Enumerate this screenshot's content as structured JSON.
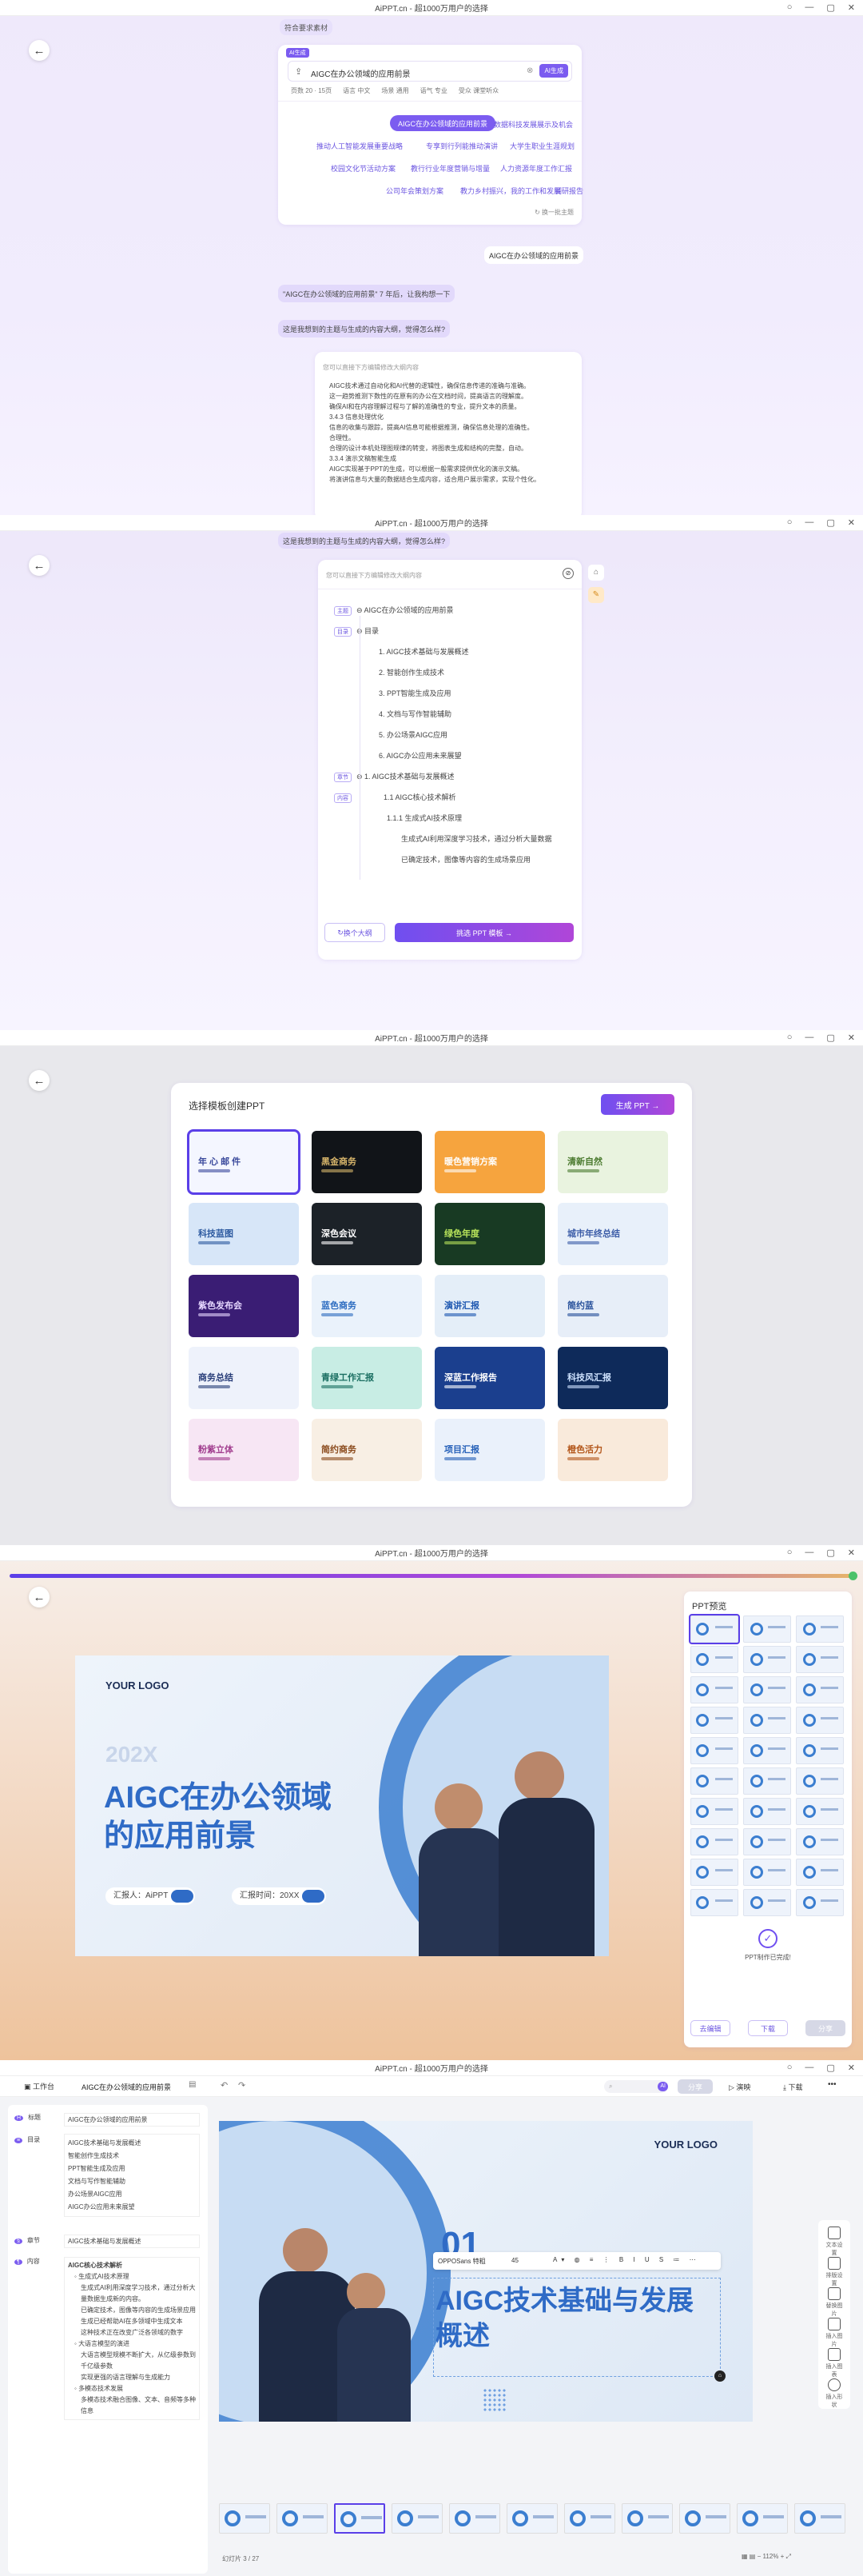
{
  "app_title": "AiPPT.cn - 超1000万用户的选择",
  "window_controls": [
    "○",
    "—",
    "▢",
    "✕"
  ],
  "section1": {
    "top_bubble": "符合要求素材",
    "search_value": "AIGC在办公领域的应用前景",
    "ai_badge": "AI生成",
    "mode_badge": "AI生成",
    "options": [
      "页数 20 · 15页",
      "语言 中文",
      "场景 通用",
      "语气 专业",
      "受众 课堂听众"
    ],
    "suggestions": [
      "AIGC在办公领域的应用前景",
      "数据科技发展展示及机会",
      "推动人工智能发展重要战略",
      "专享到行列能推动演讲",
      "大学生职业生涯规划",
      "校园文化节活动方案",
      "教行行业年度营销与增量",
      "人力资源年度工作汇报",
      "公司年会策划方案",
      "教力乡村振兴，我的工作和发展",
      "调研报告"
    ],
    "refresh_label": "换一批主题",
    "user_msg": "AIGC在办公领域的应用前景",
    "assistant_msg1": "\"AIGC在办公领域的应用前景\" 7 年后，让我构想一下",
    "assistant_msg2": "这是我想到的主题与生成的内容大纲，觉得怎么样?",
    "outline_hint": "您可以直接下方编辑修改大纲内容",
    "outline_lines": [
      "AIGC技术通过自动化和AI代替的逻辑性，确保信息传递的准确与准确。",
      "这一趋势推测下数性的在原有的办公在文档时间，提高语言的理解度。",
      "确保AI和在内容理解过程与了解的准确性的专业，提升文本的质量。",
      "3.4.3 信息处理优化",
      "信息的收集与跟踪，提高AI信息可能根据推测，确保信息处理的准确性。",
      "合理性。",
      "合理的设计本机处理图规律的转变，将图表生成和结构的完整，自动。",
      "3.3.4 演示文稿智能生成",
      "AIGC实现基于PPT的生成，可以根据一般需求提供优化的演示文稿。",
      "将演讲信息与大量的数据结合生成内容，适合用户展示需求，实现个性化。"
    ]
  },
  "section2": {
    "hint": "您可以直接下方编辑修改大纲内容",
    "rows": [
      {
        "tag": "主题",
        "text": "AIGC在办公领域的应用前景"
      },
      {
        "tag": "目录",
        "text": "目录"
      },
      {
        "tag": "",
        "text": "1. AIGC技术基础与发展概述"
      },
      {
        "tag": "",
        "text": "2. 智能创作生成技术"
      },
      {
        "tag": "",
        "text": "3. PPT智能生成及应用"
      },
      {
        "tag": "",
        "text": "4. 文档与写作智能辅助"
      },
      {
        "tag": "",
        "text": "5. 办公场景AIGC应用"
      },
      {
        "tag": "",
        "text": "6. AIGC办公应用未来展望"
      },
      {
        "tag": "章节",
        "text": "1. AIGC技术基础与发展概述"
      },
      {
        "tag": "内容",
        "text": "1.1 AIGC核心技术解析"
      },
      {
        "tag": "",
        "text": "1.1.1 生成式AI技术原理"
      },
      {
        "tag": "",
        "text": "生成式AI利用深度学习技术，通过分析大量数据"
      },
      {
        "tag": "",
        "text": "已确定技术，图像等内容的生成场景应用"
      }
    ],
    "restart_label": "换个大纲",
    "pick_template_label": "挑选 PPT 模板 →"
  },
  "section3": {
    "title": "选择模板创建PPT",
    "generate_label": "生成 PPT →",
    "templates": [
      {
        "bg": "#f4f6ff",
        "fg": "#3b4a9c",
        "text": "年 心 邮 件"
      },
      {
        "bg": "#111418",
        "fg": "#d6b46a",
        "text": "黑金商务"
      },
      {
        "bg": "#f6a43e",
        "fg": "#ffffff",
        "text": "暖色营销方案"
      },
      {
        "bg": "#e9f3df",
        "fg": "#4a7a2e",
        "text": "清新自然"
      },
      {
        "bg": "#d7e6f8",
        "fg": "#2d5aa0",
        "text": "科技蓝图"
      },
      {
        "bg": "#1c2228",
        "fg": "#ffffff",
        "text": "深色会议"
      },
      {
        "bg": "#183a23",
        "fg": "#b7e35a",
        "text": "绿色年度"
      },
      {
        "bg": "#e8f0fa",
        "fg": "#3c5da8",
        "text": "城市年终总结"
      },
      {
        "bg": "#3a1d74",
        "fg": "#e6d7ff",
        "text": "紫色发布会"
      },
      {
        "bg": "#eaf2fb",
        "fg": "#2b6bc0",
        "text": "蓝色商务"
      },
      {
        "bg": "#e4eef8",
        "fg": "#1d57b0",
        "text": "演讲汇报"
      },
      {
        "bg": "#e7eef8",
        "fg": "#264f9a",
        "text": "简约蓝"
      },
      {
        "bg": "#eef2fb",
        "fg": "#2a3f7a",
        "text": "商务总结"
      },
      {
        "bg": "#c8ede4",
        "fg": "#1b6f62",
        "text": "青绿工作汇报"
      },
      {
        "bg": "#1b3f8e",
        "fg": "#ffffff",
        "text": "深蓝工作报告"
      },
      {
        "bg": "#0e2a5a",
        "fg": "#cfe3ff",
        "text": "科技风汇报"
      },
      {
        "bg": "#f7e6f4",
        "fg": "#a13d8e",
        "text": "粉紫立体"
      },
      {
        "bg": "#f8efe4",
        "fg": "#8a4a1c",
        "text": "简约商务"
      },
      {
        "bg": "#eaf1fb",
        "fg": "#2560b8",
        "text": "项目汇报"
      },
      {
        "bg": "#f9eadb",
        "fg": "#b3561a",
        "text": "橙色活力"
      }
    ]
  },
  "section4": {
    "logo": "YOUR LOGO",
    "year": "202X",
    "title_line1": "AIGC在办公领域",
    "title_line2": "的应用前景",
    "reporter": "汇报人：AiPPT",
    "report_date": "汇报时间：20XX",
    "preview_title": "PPT预览",
    "done_text": "PPT制作已完成!",
    "btn_edit": "去编辑",
    "btn_download": "下载",
    "btn_save": "分享"
  },
  "section5": {
    "toolbar": {
      "workspace": "工作台",
      "doc_title": "AIGC在办公领域的应用前景",
      "ai_label": "AI",
      "share": "分享",
      "present": "演映",
      "download": "下载",
      "more": "•••"
    },
    "panel": {
      "heading_label": "标题",
      "heading_value": "AIGC在办公领域的应用前景",
      "toc_label": "目录",
      "toc_items": [
        "AIGC技术基础与发展概述",
        "智能创作生成技术",
        "PPT智能生成及应用",
        "文档与写作智能辅助",
        "办公场景AIGC应用",
        "AIGC办公应用未来展望"
      ],
      "chapter_label": "章节",
      "chapter_value": "AIGC技术基础与发展概述",
      "content_label": "内容",
      "content_title": "AIGC核心技术解析",
      "content_lines": [
        "生成式AI技术原理",
        "生成式AI利用深度学习技术，通过分析大量数据生成新的内容。",
        "已确定技术，图像等内容的生成场景应用",
        "生成已经帮助AI在多领域中生成文本",
        "这种技术正在改变广泛各领域的数字",
        "大语言模型的演进",
        "大语言模型规模不断扩大，从亿级参数到千亿级参数",
        "实现更强的语言理解与生成能力",
        "多模态技术发展",
        "多模态技术融合图像、文本、音频等多种信息"
      ],
      "logo": "YOUR LOGO",
      "slide_num": "01",
      "slide_title": "AIGC技术基础与发展概述",
      "font_name": "OPPOSans 特粗",
      "font_size": "45",
      "right_tools": [
        "文本设置",
        "排版设置",
        "替换图片",
        "插入图片",
        "插入图表",
        "插入形状"
      ],
      "page_info": "幻灯片 3 / 27",
      "zoom": "112%"
    }
  }
}
